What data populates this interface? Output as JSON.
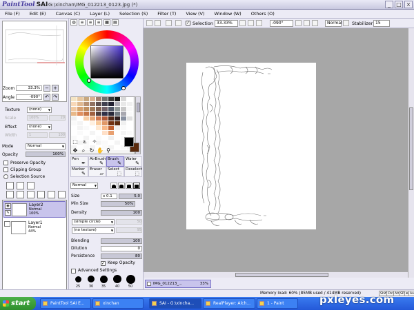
{
  "app": {
    "logo": "PaintTool",
    "logo_strong": "SAI",
    "title": "G:\\xinchan\\IMG_012213_0123.jpg (*)",
    "window_buttons": [
      "_",
      "□",
      "×"
    ]
  },
  "menubar": [
    "File (F)",
    "Edit (E)",
    "Canvas (C)",
    "Layer (L)",
    "Selection (S)",
    "Filter (T)",
    "View (V)",
    "Window (W)",
    "Others (O)"
  ],
  "navigator": {
    "zoom_label": "Zoom",
    "zoom_value": "33.3%",
    "angle_label": "Angle",
    "angle_value": "-090°"
  },
  "layer_props": {
    "texture_label": "Texture",
    "texture_value": "(none)",
    "scale_label": "Scale",
    "scale_value": "100%",
    "scale_num": "20",
    "effect_label": "Effect",
    "effect_value": "(none)",
    "width_label": "Width",
    "width_value": "1",
    "width_num": "100",
    "mode_label": "Mode",
    "mode_value": "Normal",
    "opacity_label": "Opacity",
    "opacity_value": "100%",
    "preserve_opacity": "Preserve Opacity",
    "clipping_group": "Clipping Group",
    "selection_source": "Selection Source"
  },
  "layers": [
    {
      "name": "Layer2",
      "mode": "Normal",
      "opacity": "100%",
      "selected": true
    },
    {
      "name": "Layer1",
      "mode": "Normal",
      "opacity": "44%",
      "selected": false
    }
  ],
  "brushes": [
    {
      "label": "Pen",
      "icon": "pen-icon",
      "glyph": "✒"
    },
    {
      "label": "AirBrush",
      "icon": "airbrush-icon",
      "glyph": "✎"
    },
    {
      "label": "Brush",
      "icon": "brush-icon",
      "glyph": "✎"
    },
    {
      "label": "Water",
      "icon": "water-icon",
      "glyph": "✎"
    },
    {
      "label": "Marker",
      "icon": "marker-icon",
      "glyph": "✎"
    },
    {
      "label": "Eraser",
      "icon": "eraser-icon",
      "glyph": "▱"
    },
    {
      "label": "Select",
      "icon": "select-icon",
      "glyph": "⬚"
    },
    {
      "label": "Deselect",
      "icon": "deselect-icon",
      "glyph": "⬚"
    }
  ],
  "brush_settings": {
    "mode": "Normal",
    "size_label": "Size",
    "size_mult": "x 0.1",
    "size_value": "5.0",
    "min_size_label": "Min Size",
    "min_size_value": "50%",
    "density_label": "Density",
    "density_value": "100",
    "shape_value": "(simple circle)",
    "shape_num": "50",
    "texture_value": "(no texture)",
    "texture_num": "95",
    "blending_label": "Blending",
    "blending_value": "100",
    "dilution_label": "Dilution",
    "dilution_value": "0",
    "persistence_label": "Persistence",
    "persistence_value": "80",
    "keep_opacity": "Keep Opacity",
    "advanced": "Advanced Settings",
    "preset_sizes": [
      "25",
      "30",
      "35",
      "40",
      "50"
    ]
  },
  "canvas_toolbar": {
    "selection_label": "Selection",
    "zoom": "33.33%",
    "angle": "-090°",
    "mode": "Normal",
    "stabilizer_label": "Stabilizer",
    "stabilizer_value": "15"
  },
  "doc_tab": {
    "name": "IMG_012213_...",
    "zoom": "33%"
  },
  "status": {
    "memory": "Memory load: 60% (85MB used / 414MB reserved)",
    "keys": [
      "Shift",
      "Ctrl",
      "Alt",
      "SPC",
      "⊕",
      "Any"
    ]
  },
  "taskbar": {
    "start": "start",
    "tasks": [
      "PaintTool SAI E...",
      "xinchan",
      "SAI - G:\\xincha...",
      "RealPlayer: Alch...",
      "1 - Paint"
    ]
  },
  "watermark": "pxleyes.com",
  "colors": {
    "accent": "#c8c4ec",
    "foreground_color": "#000000",
    "background_color": "#5a2a0e",
    "palette": [
      "#f4e4c4",
      "#e8c8a0",
      "#c8a880",
      "#d8b090",
      "#a08070",
      "#707070",
      "#383838",
      "#181818",
      "#d8d8d8",
      "#ffffff",
      "#f8d8b8",
      "#e0b890",
      "#b89070",
      "#907060",
      "#605050",
      "#404050",
      "#202030",
      "#b0b0b8",
      "#e8e8e8",
      "#f0f0f0",
      "#f0c8a0",
      "#d8a070",
      "#c09060",
      "#a07858",
      "#806050",
      "#706068",
      "#505868",
      "#909898",
      "#c8c8c8",
      "#f8f8f8",
      "#e8b888",
      "#e09060",
      "#c87848",
      "#a06040",
      "#504040",
      "#303048",
      "#282838",
      "#707880",
      "#a8a8b0",
      "#fafafa",
      "#f0f0f0",
      "#ffffff",
      "#f8d0a8",
      "#e8a878",
      "#d07850",
      "#b05838",
      "#502818",
      "#302020",
      "#8890a0",
      "#e0e0e0",
      "#fafafa",
      "#f4f4f4",
      "#ffffff",
      "#fff0e0",
      "#f8c898",
      "#e09868",
      "#703010",
      "#5a2a0e",
      "#f0f0f0",
      "#ffffff",
      "#ffffff",
      "#f4f4f4",
      "#fafafa",
      "#ffffff",
      "#ffe8d0",
      "#f8b888",
      "#c06030",
      "#f0f0f0",
      "#fafafa",
      "#ffffff",
      "#ffffff",
      "#fafafa",
      "#ffffff",
      "#f4f4f4",
      "#ffffff",
      "#ffe0c8",
      "#e8a070",
      "#ffffff",
      "#f4f4f4",
      "#fafafa",
      "#fafafa",
      "#ffffff",
      "#f4f4f4",
      "#ffffff",
      "#fafafa",
      "#ffffff",
      "#f0f0f0",
      "#ffffff",
      "#fafafa",
      "#ffffff",
      "#ffffff",
      "#f4f4f4",
      "#fafafa",
      "#ffffff",
      "#f4f4f4",
      "#fafafa",
      "#ffffff",
      "#f4f4f4",
      "#ffffff",
      "#fafafa",
      "#f4f4f4",
      "#ffffff",
      "#fafafa",
      "#f4f4f4",
      "#ffffff",
      "#fafafa",
      "#f4f4f4",
      "#ffffff",
      "#fafafa",
      "#f4f4f4"
    ]
  }
}
